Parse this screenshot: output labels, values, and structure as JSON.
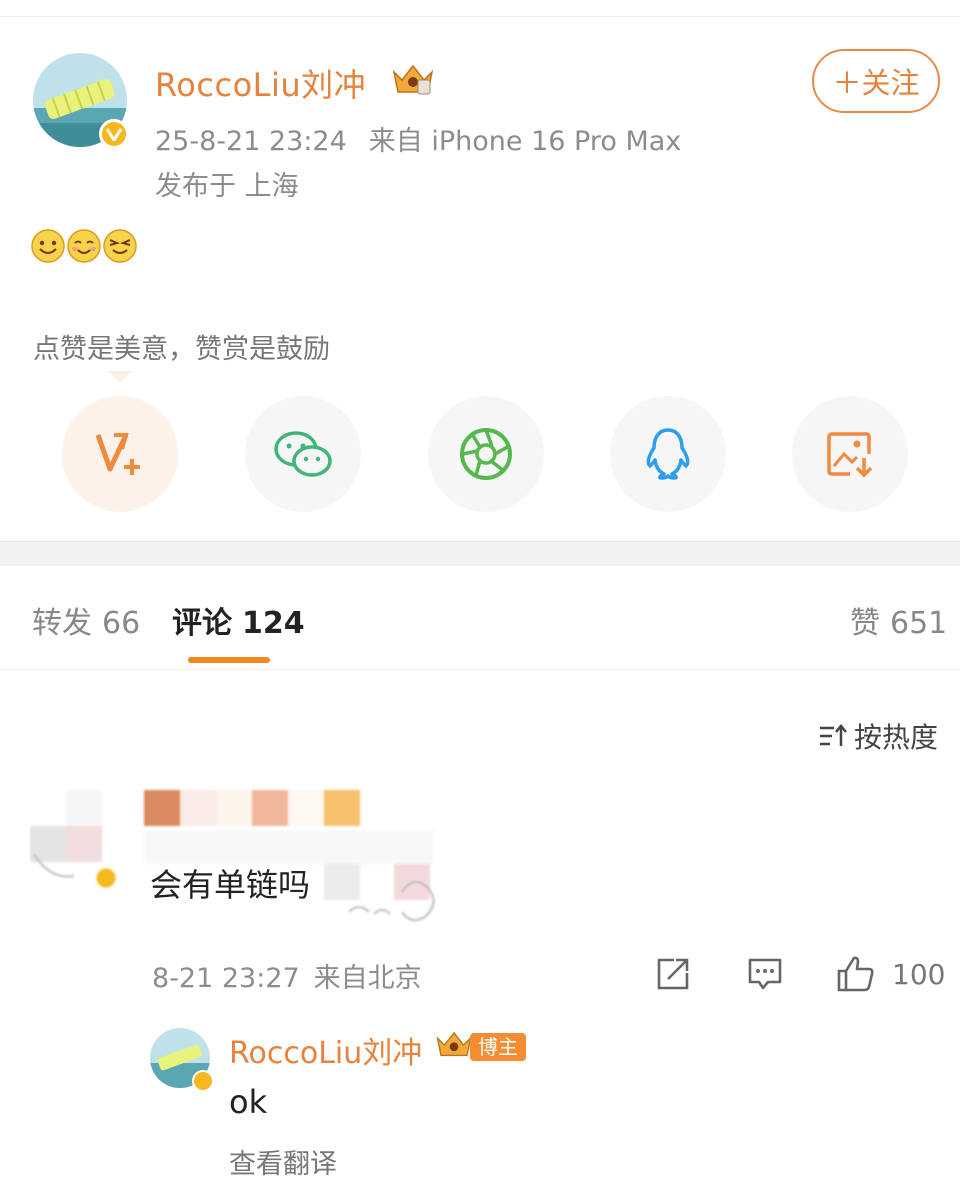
{
  "post": {
    "username": "RoccoLiu刘冲",
    "follow_label": "＋关注",
    "time": "25-8-21 23:24",
    "source": "来自 iPhone 16 Pro Max",
    "location": "发布于 上海",
    "emojis": [
      "smile-emoji",
      "shy-emoji",
      "wink-emoji"
    ],
    "reward_text": "点赞是美意，赞赏是鼓励"
  },
  "share": [
    "v-plus-icon",
    "wechat-icon",
    "moments-icon",
    "qq-icon",
    "save-image-icon"
  ],
  "tabs": {
    "repost_label": "转发",
    "repost_count": "66",
    "comment_label": "评论",
    "comment_count": "124",
    "like_label": "赞",
    "like_count": "651"
  },
  "sort_label": "按热度",
  "comment": {
    "text": "会有单链吗",
    "time": "8-21 23:27",
    "source": "来自北京",
    "like_count": "100"
  },
  "reply": {
    "username": "RoccoLiu刘冲",
    "badge": "博主",
    "text": "ok",
    "translate_label": "查看翻译"
  },
  "colors": {
    "accent": "#e8823a",
    "tab_underline": "#f08a1e",
    "verified": "#f6b81d"
  }
}
